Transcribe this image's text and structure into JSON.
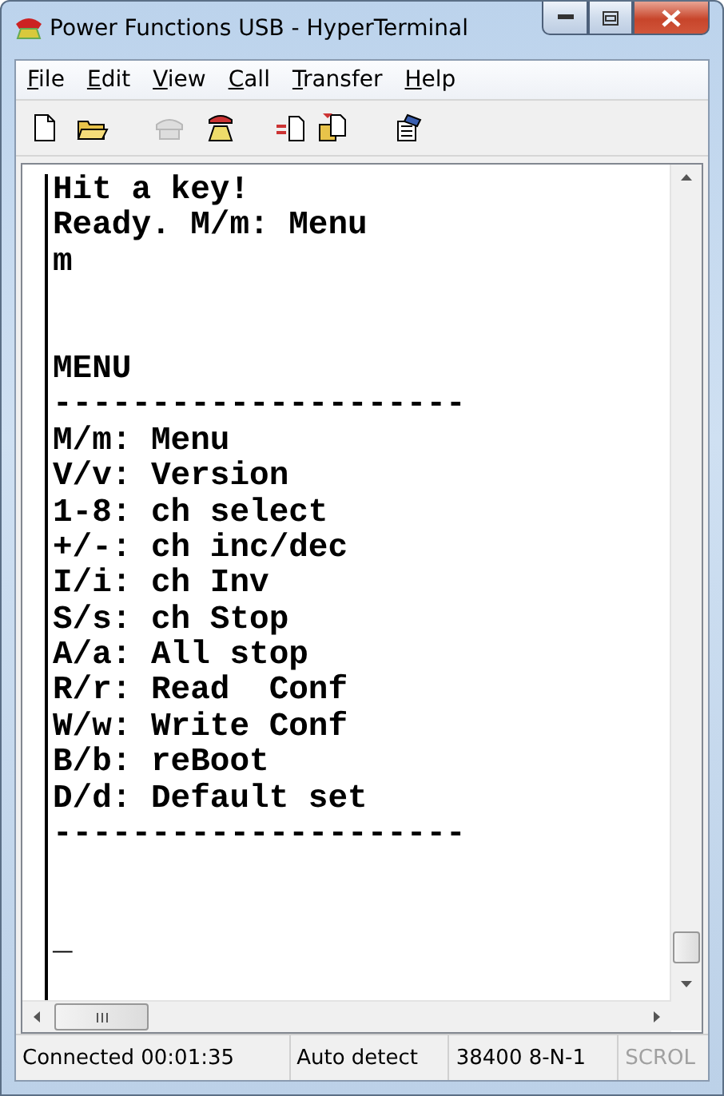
{
  "window": {
    "title": "Power Functions USB - HyperTerminal"
  },
  "menu": [
    "File",
    "Edit",
    "View",
    "Call",
    "Transfer",
    "Help"
  ],
  "toolbar": [
    {
      "kind": "new",
      "disabled": false
    },
    {
      "kind": "open",
      "disabled": false
    },
    {
      "kind": "phone",
      "disabled": true
    },
    {
      "kind": "hangup",
      "disabled": false
    },
    {
      "kind": "send",
      "disabled": false
    },
    {
      "kind": "receive",
      "disabled": false
    },
    {
      "kind": "properties",
      "disabled": false
    }
  ],
  "terminal": {
    "blocks": [
      [
        "Hit a key!",
        "Ready. M/m: Menu",
        "m"
      ],
      [
        "MENU",
        "---------------------",
        "M/m: Menu",
        "V/v: Version",
        "1-8: ch select",
        "+/-: ch inc/dec",
        "I/i: ch Inv",
        "S/s: ch Stop",
        "A/a: All stop",
        "R/r: Read  Conf",
        "W/w: Write Conf",
        "B/b: reBoot",
        "D/d: Default set",
        "---------------------"
      ],
      [
        "_"
      ]
    ]
  },
  "status_bar": [
    {
      "text": "Connected 00:01:35",
      "disabled": false
    },
    {
      "text": "Auto detect",
      "disabled": false
    },
    {
      "text": "38400 8-N-1",
      "disabled": false
    },
    {
      "text": "SCROL",
      "disabled": true
    }
  ]
}
